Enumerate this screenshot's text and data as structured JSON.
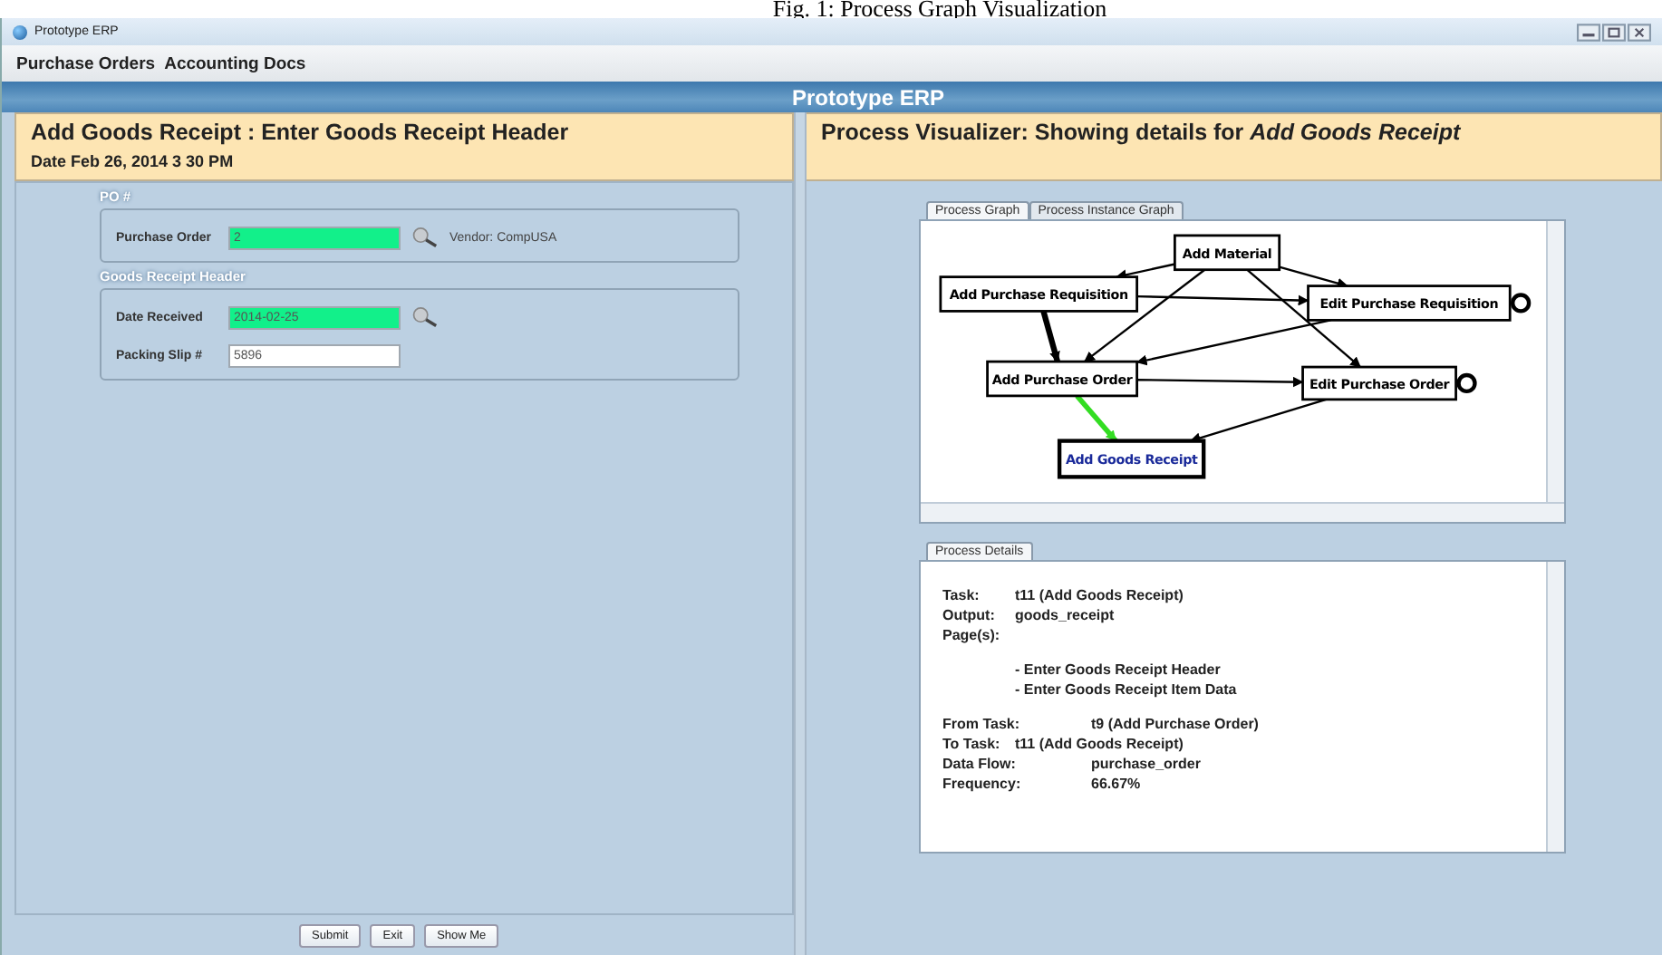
{
  "caption": "Fig. 1: Process Graph Visualization",
  "window": {
    "title": "Prototype ERP"
  },
  "menu": [
    "Purchase Orders",
    "Accounting Docs"
  ],
  "banner": "Prototype ERP",
  "left": {
    "title": "Add Goods Receipt : Enter Goods Receipt Header",
    "date": "Date Feb 26, 2014  3 30 PM",
    "groups": [
      {
        "legend": "PO #",
        "fields": [
          {
            "label": "Purchase Order",
            "value": "2",
            "highlighted": true,
            "lookup": true,
            "note": "Vendor: CompUSA"
          }
        ]
      },
      {
        "legend": "Goods Receipt Header",
        "fields": [
          {
            "label": "Date Received",
            "value": "2014-02-25",
            "highlighted": true,
            "lookup": true
          },
          {
            "label": "Packing Slip #",
            "value": "5896",
            "highlighted": false,
            "lookup": false
          }
        ]
      }
    ],
    "buttons": [
      "Submit",
      "Exit",
      "Show Me"
    ]
  },
  "right": {
    "title_prefix": "Process Visualizer: Showing details for ",
    "title_task": "Add Goods Receipt",
    "graph_tabs": [
      {
        "label": "Process Graph",
        "selected": true
      },
      {
        "label": "Process Instance Graph",
        "selected": false
      }
    ],
    "nodes": [
      {
        "label": "Add Material",
        "current": false,
        "end_marker": false
      },
      {
        "label": "Add Purchase Requisition",
        "current": false,
        "end_marker": false
      },
      {
        "label": "Edit Purchase Requisition",
        "current": false,
        "end_marker": true
      },
      {
        "label": "Add Purchase Order",
        "current": false,
        "end_marker": false
      },
      {
        "label": "Edit Purchase Order",
        "current": false,
        "end_marker": true
      },
      {
        "label": "Add Goods Receipt",
        "current": true,
        "end_marker": false
      }
    ],
    "edges": [
      {
        "heavy": false,
        "highlighted": false
      },
      {
        "heavy": false,
        "highlighted": false
      },
      {
        "heavy": false,
        "highlighted": false
      },
      {
        "heavy": false,
        "highlighted": false
      },
      {
        "heavy": false,
        "highlighted": false
      },
      {
        "heavy": true,
        "highlighted": false
      },
      {
        "heavy": false,
        "highlighted": false
      },
      {
        "heavy": false,
        "highlighted": false
      },
      {
        "heavy": false,
        "highlighted": true
      },
      {
        "heavy": false,
        "highlighted": false
      }
    ],
    "details_tab": {
      "label": "Process Details",
      "selected": true
    },
    "details": [
      [
        {
          "label": "Task:",
          "value": "t11 (Add Goods Receipt)"
        },
        {
          "label": "Output:",
          "value": "goods_receipt"
        },
        {
          "label": "Page(s):"
        }
      ],
      [
        {
          "value": "- Enter Goods Receipt Header"
        },
        {
          "value": "- Enter Goods Receipt Item Data"
        }
      ],
      [
        {
          "label": "From Task:",
          "value": "t9 (Add Purchase Order)",
          "wide": true
        },
        {
          "label": "To Task:",
          "value": "t11 (Add Goods Receipt)",
          "wide": false
        },
        {
          "label": "Data Flow:",
          "value": "purchase_order",
          "wide": true
        },
        {
          "label": "Frequency:",
          "value": "66.67%",
          "wide": true
        }
      ]
    ]
  }
}
